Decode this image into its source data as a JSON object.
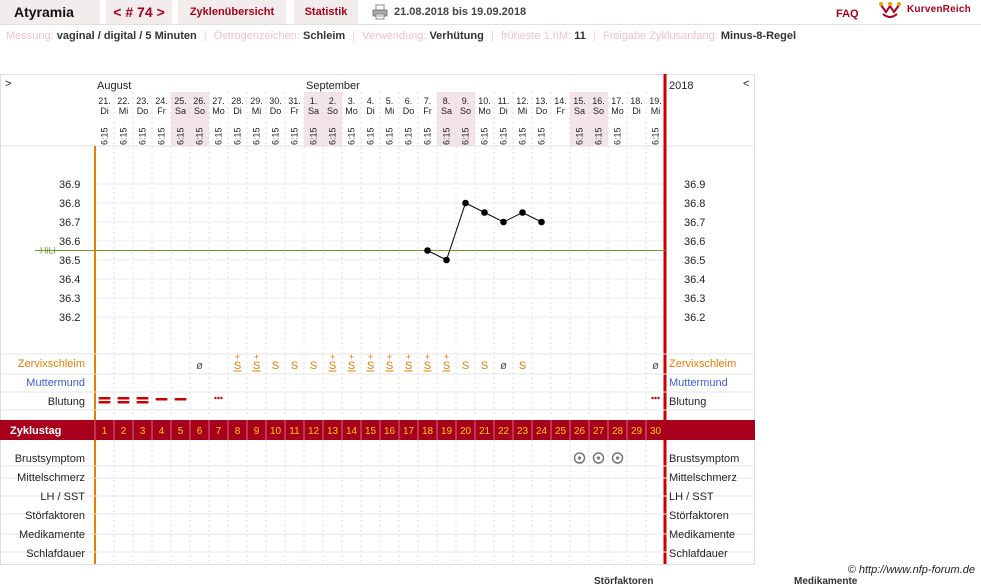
{
  "header": {
    "brand": "Atyramia",
    "cycle_prev": "<",
    "cycle_label": "# 74",
    "cycle_next": ">",
    "tab_overview": "Zyklenübersicht",
    "tab_stats": "Statistik",
    "date_range": "21.08.2018 bis 19.09.2018",
    "faq": "FAQ",
    "logo_text": "KurvenReich"
  },
  "settings": [
    {
      "label": "Messung:",
      "value": "vaginal / digital / 5 Minuten"
    },
    {
      "label": "Östrogenzeichen:",
      "value": "Schleim"
    },
    {
      "label": "Verwendung:",
      "value": "Verhütung"
    },
    {
      "label": "früheste 1.hM:",
      "value": "11"
    },
    {
      "label": "Freigabe Zyklusanfang:",
      "value": "Minus-8-Regel"
    }
  ],
  "chart": {
    "nav_left": ">",
    "nav_right": "<",
    "year": "2018",
    "month_labels": [
      {
        "text": "August",
        "day_index": 0
      },
      {
        "text": "September",
        "day_index": 11
      }
    ],
    "days": [
      {
        "d": "21.",
        "w": "Di",
        "we": false
      },
      {
        "d": "22.",
        "w": "Mi",
        "we": false
      },
      {
        "d": "23.",
        "w": "Do",
        "we": false
      },
      {
        "d": "24.",
        "w": "Fr",
        "we": false
      },
      {
        "d": "25.",
        "w": "Sa",
        "we": true
      },
      {
        "d": "26.",
        "w": "So",
        "we": true
      },
      {
        "d": "27.",
        "w": "Mo",
        "we": false
      },
      {
        "d": "28.",
        "w": "Di",
        "we": false
      },
      {
        "d": "29.",
        "w": "Mi",
        "we": false
      },
      {
        "d": "30.",
        "w": "Do",
        "we": false
      },
      {
        "d": "31.",
        "w": "Fr",
        "we": false
      },
      {
        "d": "1.",
        "w": "Sa",
        "we": true
      },
      {
        "d": "2.",
        "w": "So",
        "we": true
      },
      {
        "d": "3.",
        "w": "Mo",
        "we": false
      },
      {
        "d": "4.",
        "w": "Di",
        "we": false
      },
      {
        "d": "5.",
        "w": "Mi",
        "we": false
      },
      {
        "d": "6.",
        "w": "Do",
        "we": false
      },
      {
        "d": "7.",
        "w": "Fr",
        "we": false
      },
      {
        "d": "8.",
        "w": "Sa",
        "we": true
      },
      {
        "d": "9.",
        "w": "So",
        "we": true
      },
      {
        "d": "10.",
        "w": "Mo",
        "we": false
      },
      {
        "d": "11.",
        "w": "Di",
        "we": false
      },
      {
        "d": "12.",
        "w": "Mi",
        "we": false
      },
      {
        "d": "13.",
        "w": "Do",
        "we": false
      },
      {
        "d": "14.",
        "w": "Fr",
        "we": false
      },
      {
        "d": "15.",
        "w": "Sa",
        "we": true
      },
      {
        "d": "16.",
        "w": "So",
        "we": true
      },
      {
        "d": "17.",
        "w": "Mo",
        "we": false
      },
      {
        "d": "18.",
        "w": "Di",
        "we": false
      },
      {
        "d": "19.",
        "w": "Mi",
        "we": false
      }
    ],
    "time_labels": [
      "6:15",
      "6:15",
      "6:15",
      "6:15",
      "6:15",
      "6:15",
      "6:15",
      "6:15",
      "6:15",
      "6:15",
      "6:15",
      "6:15",
      "6:15",
      "6:15",
      "6:15",
      "6:15",
      "6:15",
      "6:15",
      "6:15",
      "6:15",
      "6:15",
      "6:15",
      "6:15",
      "6:15",
      "",
      "6:15",
      "6:15",
      "6:15",
      "",
      "6:15"
    ],
    "y_ticks": [
      "36.9",
      "36.8",
      "36.7",
      "36.6",
      "36.5",
      "36.4",
      "36.3",
      "36.2"
    ],
    "hili_label": "HiLi",
    "hili_value": 36.55,
    "temperatures": [
      null,
      null,
      null,
      null,
      null,
      null,
      null,
      null,
      null,
      null,
      null,
      null,
      null,
      null,
      null,
      null,
      null,
      36.55,
      36.5,
      36.8,
      36.75,
      36.7,
      36.75,
      36.7,
      null,
      null,
      null,
      null,
      null,
      null
    ],
    "rows": {
      "cervix": "Zervixschleim",
      "cervix_os": "Muttermund",
      "bleeding": "Blutung",
      "cycle_day": "Zyklustag",
      "breast": "Brustsymptom",
      "midpain": "Mittelschmerz",
      "lh": "LH / SST",
      "disturb": "Störfaktoren",
      "meds": "Medikamente",
      "sleep": "Schlafdauer"
    },
    "cervix_symbols": [
      "",
      "",
      "",
      "",
      "",
      "ø",
      "",
      "S+",
      "S+",
      "S",
      "S",
      "S",
      "S+",
      "S+",
      "S+",
      "S+",
      "S+",
      "S+",
      "S+",
      "S",
      "S",
      "ø",
      "S",
      "",
      "",
      "",
      "",
      "",
      "",
      "ø"
    ],
    "bleeding": [
      "heavy",
      "heavy",
      "heavy",
      "medium",
      "medium",
      "",
      "spotting",
      "",
      "",
      "",
      "",
      "",
      "",
      "",
      "",
      "",
      "",
      "",
      "",
      "",
      "",
      "",
      "",
      "",
      "",
      "",
      "",
      "",
      "",
      "spotting"
    ],
    "cycle_days": [
      "1",
      "2",
      "3",
      "4",
      "5",
      "6",
      "7",
      "8",
      "9",
      "10",
      "11",
      "12",
      "13",
      "14",
      "15",
      "16",
      "17",
      "18",
      "19",
      "20",
      "21",
      "22",
      "23",
      "24",
      "25",
      "26",
      "27",
      "28",
      "29",
      "30"
    ],
    "breast_symptom_days": [
      25,
      26,
      27
    ],
    "colors": {
      "accent": "#a8001c",
      "orange": "#e87b00",
      "blue": "#3d5bd6",
      "weekend": "#f3e4ea",
      "hili": "#6a9a2a"
    }
  },
  "copyright": "© http://www.nfp-forum.de",
  "footer": {
    "left": "Störfaktoren",
    "right": "Medikamente"
  }
}
